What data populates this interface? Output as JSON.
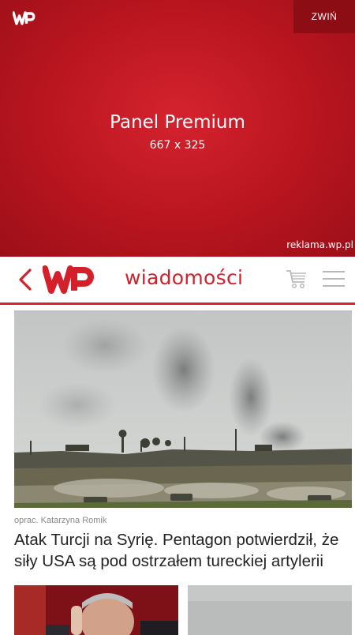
{
  "ad": {
    "collapse_label": "ZWIŃ",
    "title": "Panel Premium",
    "size": "667 x 325",
    "link": "reklama.wp.pl"
  },
  "header": {
    "section": "wiadomości"
  },
  "article": {
    "byline": "oprac. Katarzyna Romik",
    "headline": "Atak Turcji na Syrię. Pentagon potwierdził, że siły USA są pod ostrzałem tureckiej artylerii"
  },
  "colors": {
    "brand_red": "#d4202b",
    "ad_red": "#b8151f",
    "collapse_bg": "#8d0d15"
  },
  "icons": [
    "wp-logo-icon",
    "back-arrow-icon",
    "cart-icon",
    "hamburger-menu-icon"
  ]
}
